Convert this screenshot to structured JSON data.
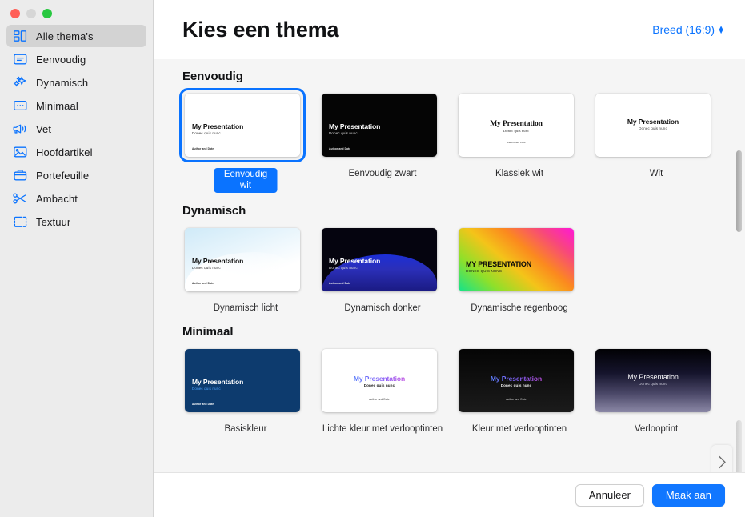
{
  "window": {
    "traffic_lights": [
      "close",
      "minimize",
      "maximize"
    ]
  },
  "sidebar": {
    "items": [
      {
        "label": "Alle thema's",
        "icon": "all-themes-icon",
        "selected": true
      },
      {
        "label": "Eenvoudig",
        "icon": "simple-icon",
        "selected": false
      },
      {
        "label": "Dynamisch",
        "icon": "sparkles-icon",
        "selected": false
      },
      {
        "label": "Minimaal",
        "icon": "minimal-icon",
        "selected": false
      },
      {
        "label": "Vet",
        "icon": "megaphone-icon",
        "selected": false
      },
      {
        "label": "Hoofdartikel",
        "icon": "photo-icon",
        "selected": false
      },
      {
        "label": "Portefeuille",
        "icon": "briefcase-icon",
        "selected": false
      },
      {
        "label": "Ambacht",
        "icon": "scissors-icon",
        "selected": false
      },
      {
        "label": "Textuur",
        "icon": "texture-icon",
        "selected": false
      }
    ]
  },
  "header": {
    "title": "Kies een thema",
    "aspect_label": "Breed (16:9)"
  },
  "slide_sample": {
    "title": "My Presentation",
    "subtitle": "Donec quis nunc",
    "author": "Author and Date",
    "title_caps": "MY PRESENTATION",
    "subtitle_caps": "DONEC QUIS NUNC"
  },
  "sections": [
    {
      "title": "Eenvoudig",
      "themes": [
        {
          "name": "Eenvoudig wit",
          "style": "th-white",
          "selected": true
        },
        {
          "name": "Eenvoudig zwart",
          "style": "th-black",
          "selected": false
        },
        {
          "name": "Klassiek wit",
          "style": "th-classic",
          "selected": false
        },
        {
          "name": "Wit",
          "style": "th-plainwhite",
          "selected": false
        }
      ]
    },
    {
      "title": "Dynamisch",
      "themes": [
        {
          "name": "Dynamisch licht",
          "style": "th-dynlight",
          "selected": false
        },
        {
          "name": "Dynamisch donker",
          "style": "th-dyndark",
          "selected": false
        },
        {
          "name": "Dynamische regenboog",
          "style": "th-rainbow",
          "selected": false
        }
      ]
    },
    {
      "title": "Minimaal",
      "themes": [
        {
          "name": "Basiskleur",
          "style": "th-navy",
          "selected": false
        },
        {
          "name": "Lichte kleur met verlooptinten",
          "style": "th-lightgrad",
          "selected": false
        },
        {
          "name": "Kleur met verlooptinten",
          "style": "th-darkgrad",
          "selected": false
        },
        {
          "name": "Verlooptint",
          "style": "th-verlooptint",
          "selected": false
        }
      ]
    }
  ],
  "footer": {
    "cancel_label": "Annuleer",
    "create_label": "Maak aan"
  },
  "colors": {
    "accent": "#0a73ff",
    "primary_button": "#1177ff",
    "sidebar_bg": "#ececec",
    "content_bg": "#f5f5f5"
  }
}
